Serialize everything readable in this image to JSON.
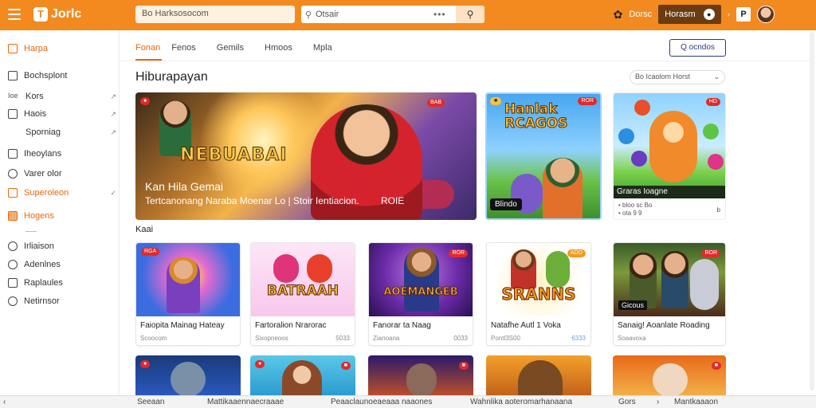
{
  "header": {
    "logo_text": "Jorlc",
    "field_1": "Bo Harksosocom",
    "search_placeholder": "Otsair",
    "search_dots": "•••",
    "link_1": "Dorsc",
    "account_button": "Horasm",
    "square_letter": "P",
    "accent": "#f28a1f"
  },
  "sidebar": {
    "items": [
      {
        "label": "Harpa"
      },
      {
        "label": "Bochsplont"
      },
      {
        "label": "Kors"
      },
      {
        "label": "Haois"
      },
      {
        "label": "Sporniag"
      },
      {
        "label": "Iheoylans"
      },
      {
        "label": "Varer olor"
      },
      {
        "label": "Superoleon"
      },
      {
        "label": "Hogens"
      },
      {
        "label": "Irliaison"
      },
      {
        "label": "Adenlnes"
      },
      {
        "label": "Raplaules"
      },
      {
        "label": "Netirnsor"
      }
    ],
    "small_tag": "Ioe"
  },
  "tabs": [
    "Fonan",
    "Fenos",
    "Gemils",
    "Hmoos",
    "Mpla"
  ],
  "outline_button": "Q ocndos",
  "section_title": "Hiburapayan",
  "sort_label": "Bo Icaolom Horst",
  "banner": {
    "headline": "NEBUABAI",
    "title": "Kan Hila Gemai",
    "subtitle": "Tertcanonang Naraba Moenar Lo | Stoir Ientiacion.",
    "sub_code": "ROIE",
    "badge": "BAB"
  },
  "featured": [
    {
      "art_text": "Hanlak RCAGOS",
      "label": "Blindo",
      "badge": "ROR"
    },
    {
      "label": "Graras Ioagne",
      "meta": "• bloo sc Bo",
      "meta2": "• ota 9 9",
      "meta3": "b"
    }
  ],
  "section2_title": "Kaai",
  "cards": [
    {
      "title": "Faiopita Mainag Hateay",
      "meta": "Scoocom",
      "meta2": "",
      "badge": "RGA"
    },
    {
      "title": "Fartoralion Nrarorac",
      "meta": "Sixopneoos",
      "meta2": "5033",
      "badge": "",
      "art_text": "BATRAAH"
    },
    {
      "title": "Fanorar ta Naag",
      "meta": "Zianoana",
      "meta2": "0033",
      "badge": "ROR",
      "art_text": "AOEMANGEB"
    },
    {
      "title": "Natafhe Autl 1 Voka",
      "meta": "Pontl3S00",
      "meta2": "6333",
      "badge": "ADO",
      "art_text": "SRANNS"
    },
    {
      "title": "Sanaig! Aoanlate Roading",
      "meta": "Soaavoxa",
      "meta2": "",
      "badge": "ROR",
      "overlay": "Gicous"
    }
  ],
  "bottom_bar": {
    "items": [
      "Seeaan",
      "Mattikaaennaecraaae",
      "Peaaclaunoeaeaaa naaones",
      "Wahnlika aoteromarhanaana",
      "Gors",
      "Mantkaaaon"
    ]
  }
}
